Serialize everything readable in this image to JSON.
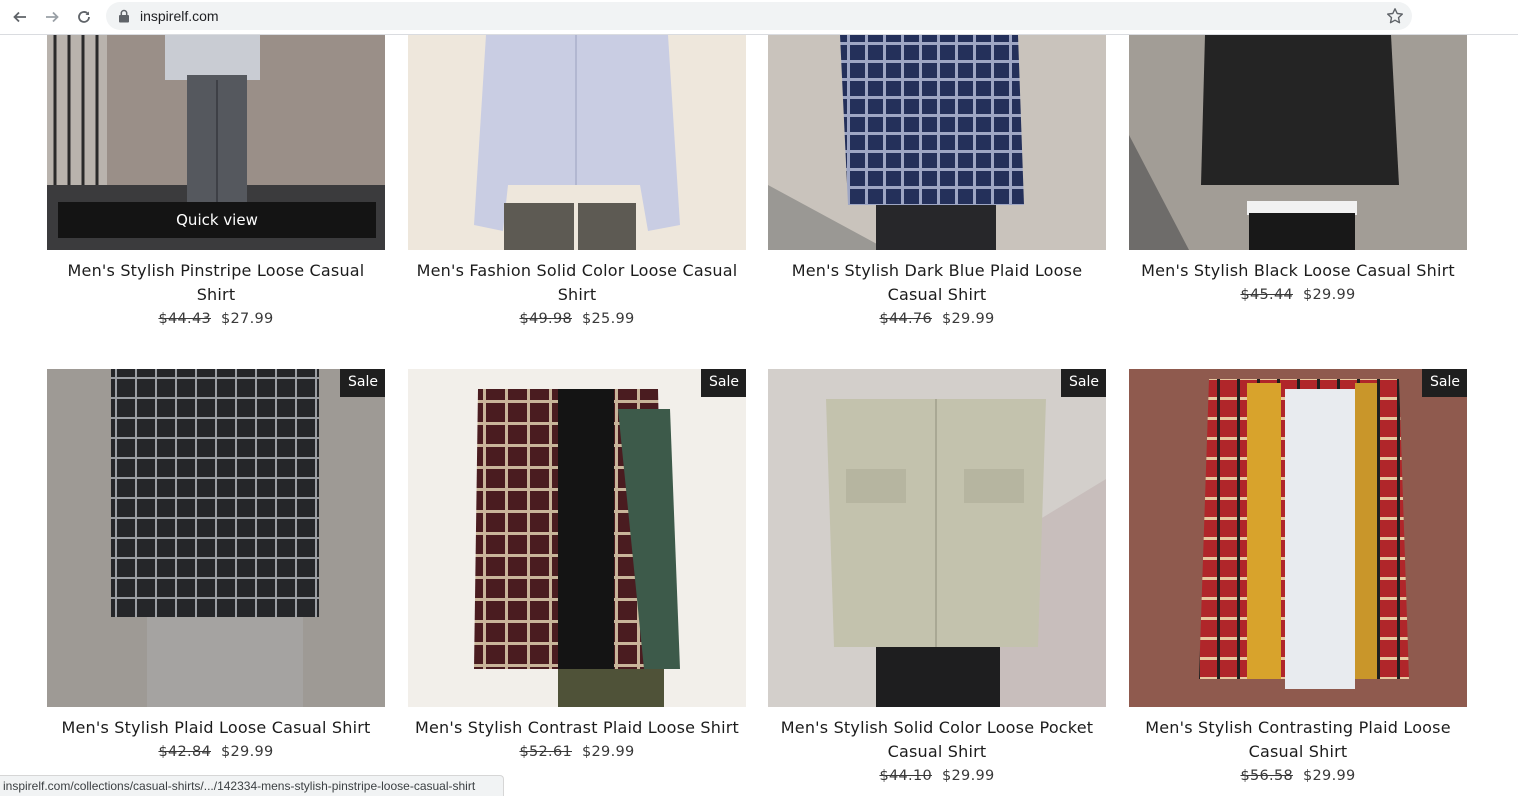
{
  "browser": {
    "url": "inspirelf.com",
    "status_url": "inspirelf.com/collections/casual-shirts/.../142334-mens-stylish-pinstripe-loose-casual-shirt"
  },
  "products": [
    {
      "title": "Men's Stylish Pinstripe Loose Casual Shirt",
      "old_price": "$44.43",
      "price": "$27.99",
      "quick_view": "Quick view"
    },
    {
      "title": "Men's Fashion Solid Color Loose Casual Shirt",
      "old_price": "$49.98",
      "price": "$25.99"
    },
    {
      "title": "Men's Stylish Dark Blue Plaid Loose Casual Shirt",
      "old_price": "$44.76",
      "price": "$29.99"
    },
    {
      "title": "Men's Stylish Black Loose Casual Shirt",
      "old_price": "$45.44",
      "price": "$29.99"
    },
    {
      "title": "Men's Stylish Plaid Loose Casual Shirt",
      "old_price": "$42.84",
      "price": "$29.99",
      "badge": "Sale"
    },
    {
      "title": "Men's Stylish Contrast Plaid Loose Shirt",
      "old_price": "$52.61",
      "price": "$29.99",
      "badge": "Sale"
    },
    {
      "title": "Men's Stylish Solid Color Loose Pocket Casual Shirt",
      "old_price": "$44.10",
      "price": "$29.99",
      "badge": "Sale"
    },
    {
      "title": "Men's Stylish Contrasting Plaid Loose Casual Shirt",
      "old_price": "$56.58",
      "price": "$29.99",
      "badge": "Sale"
    }
  ],
  "colors": {
    "badge_bg": "#1f1f1f",
    "quick_view_bg": "#141414"
  },
  "icons": [
    "back-arrow-icon",
    "forward-arrow-icon",
    "reload-icon",
    "lock-icon",
    "bookmark-star-icon"
  ]
}
